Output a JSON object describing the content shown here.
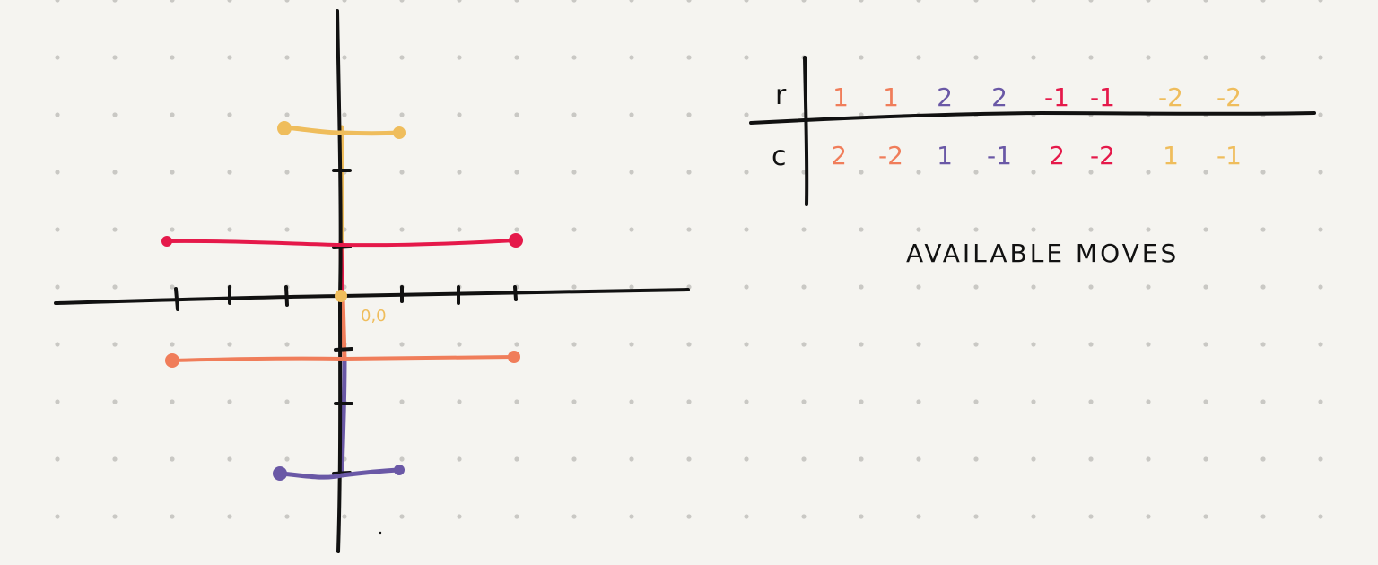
{
  "colors": {
    "background": "#f5f4f0",
    "dot": "#c9c8c4",
    "ink": "#111111",
    "orange": "#f07d5a",
    "yellow": "#efbd5c",
    "purple": "#6a58a6",
    "red": "#e5194a"
  },
  "diagram": {
    "origin_label": "0,0",
    "bars": [
      {
        "id": "row-minus-2",
        "color_key": "yellow",
        "from": -1,
        "to": 1
      },
      {
        "id": "row-minus-1",
        "color_key": "red",
        "from": -3,
        "to": 3
      },
      {
        "id": "row-plus-1",
        "color_key": "orange",
        "from": -3,
        "to": 3
      },
      {
        "id": "row-plus-2",
        "color_key": "purple",
        "from": -1,
        "to": 1
      }
    ]
  },
  "table": {
    "row_header": "r",
    "col_header": "c",
    "moves": [
      {
        "r": "1",
        "c": "2",
        "color_key": "orange"
      },
      {
        "r": "1",
        "c": "-2",
        "color_key": "orange"
      },
      {
        "r": "2",
        "c": "1",
        "color_key": "purple"
      },
      {
        "r": "2",
        "c": "-1",
        "color_key": "purple"
      },
      {
        "r": "-1",
        "c": "2",
        "color_key": "red"
      },
      {
        "r": "-1",
        "c": "-2",
        "color_key": "red"
      },
      {
        "r": "-2",
        "c": "1",
        "color_key": "yellow"
      },
      {
        "r": "-2",
        "c": "-1",
        "color_key": "yellow"
      }
    ],
    "caption": "AVAILABLE MOVES"
  }
}
